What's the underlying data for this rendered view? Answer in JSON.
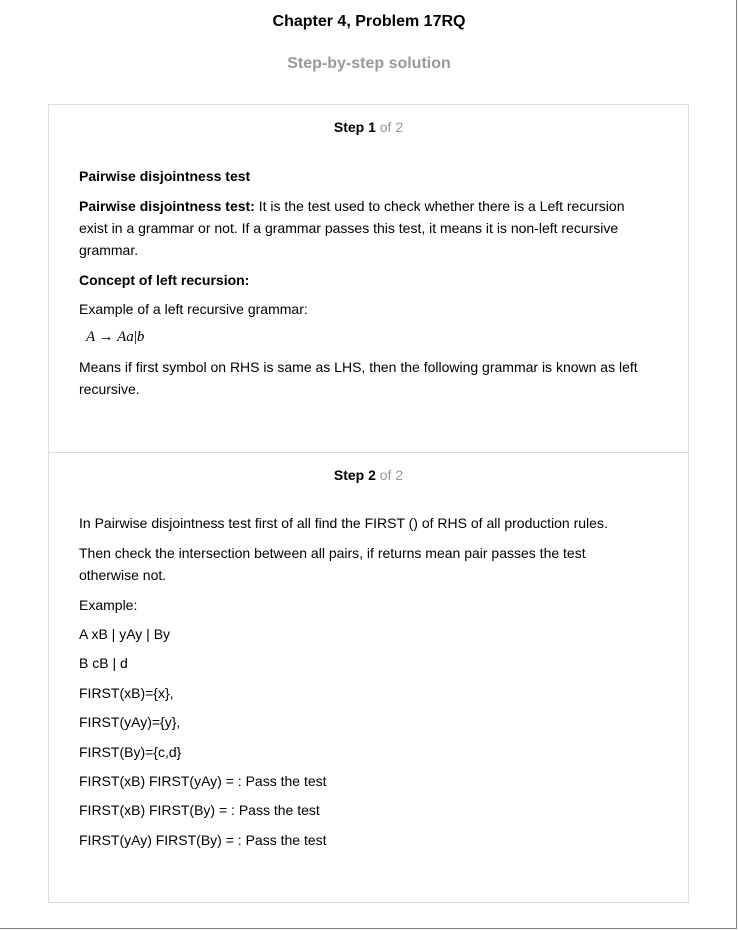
{
  "header": {
    "title": "Chapter 4, Problem 17RQ",
    "subtitle": "Step-by-step solution"
  },
  "steps": [
    {
      "label": "Step 1",
      "total": "of 2",
      "heading": "Pairwise disjointness test",
      "definition_term": "Pairwise disjointness test:",
      "definition_line1": " It is the test used to check whether there is a Left recursion",
      "definition_line2": "exist in a grammar or not. If a grammar passes this test, it means it is non-left recursive",
      "definition_line3": "grammar.",
      "concept_heading": "Concept of left recursion:",
      "example_intro": "Example of a left recursive grammar:",
      "formula": {
        "lhs": "A",
        "arrow": "→",
        "rhs1": "Aa",
        "bar": "|",
        "rhs2": "b"
      },
      "explanation_line1": "Means if first symbol on RHS is same as LHS, then the following grammar is known as left",
      "explanation_line2": "recursive."
    },
    {
      "label": "Step 2",
      "total": "of 2",
      "intro": "In Pairwise disjointness test first of all find the FIRST () of RHS of all production rules.",
      "check_line1": "Then check the intersection between all pairs, if returns mean pair passes the test",
      "check_line2": "otherwise not.",
      "example_label": "Example:",
      "lines": [
        "A xB | yAy | By",
        "B cB | d",
        "FIRST(xB)={x},",
        "FIRST(yAy)={y},",
        "FIRST(By)={c,d}",
        "FIRST(xB) FIRST(yAy) = : Pass the test",
        "FIRST(xB) FIRST(By) = : Pass the test",
        "FIRST(yAy) FIRST(By) = : Pass the test"
      ]
    }
  ]
}
